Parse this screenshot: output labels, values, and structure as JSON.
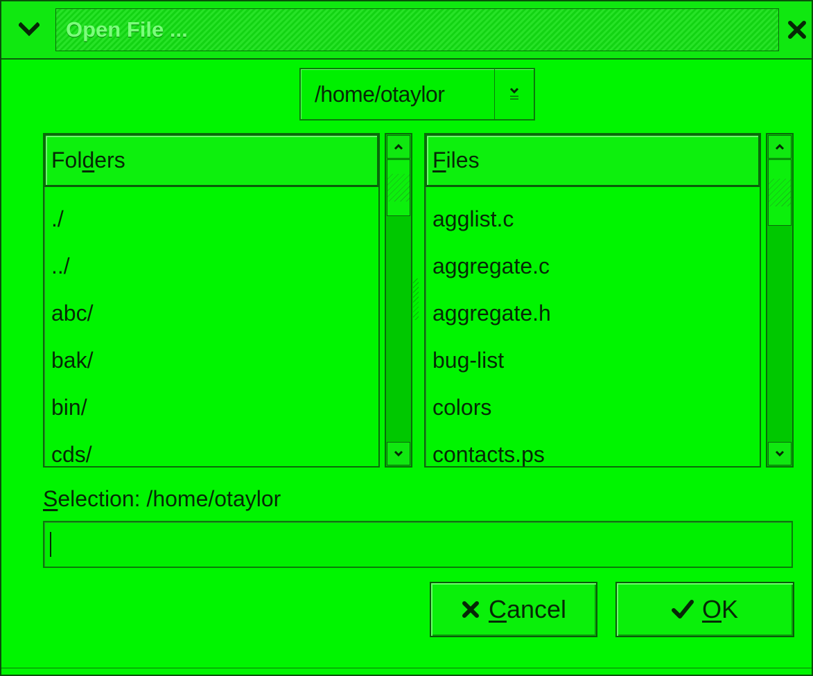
{
  "window": {
    "title": "Open File ...",
    "accent_color": "#00f000",
    "menu_icon": "chevron-down-icon",
    "close_icon": "close-icon"
  },
  "path_combo": {
    "value": "/home/otaylor",
    "icon": "chevron-down-icon"
  },
  "folders": {
    "header_pre": "Fol",
    "header_underline": "d",
    "header_post": "ers",
    "items": [
      "./",
      "../",
      "abc/",
      "bak/",
      "bin/",
      "cds/"
    ]
  },
  "files": {
    "header_underline": "F",
    "header_post": "iles",
    "items": [
      "agglist.c",
      "aggregate.c",
      "aggregate.h",
      "bug-list",
      "colors",
      "contacts.ps"
    ]
  },
  "selection": {
    "label_underline": "S",
    "label_post": "election: /home/otaylor",
    "input_value": ""
  },
  "buttons": {
    "cancel_underline": "C",
    "cancel_post": "ancel",
    "cancel_icon": "close-icon",
    "ok_underline": "O",
    "ok_post": "K",
    "ok_icon": "checkmark-icon"
  }
}
